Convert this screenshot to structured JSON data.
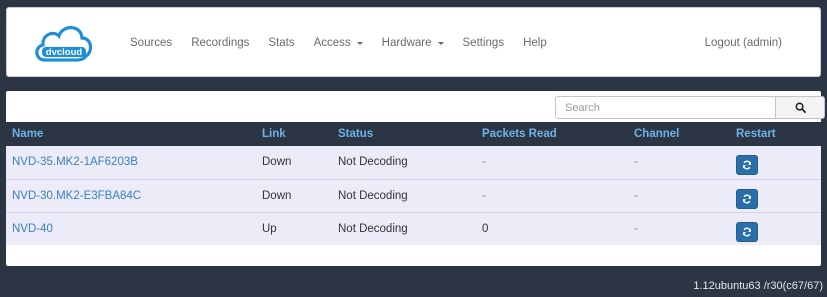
{
  "brand": {
    "logo_text": "dvcloud",
    "accent": "#1e8fd6"
  },
  "nav": {
    "items": [
      {
        "label": "Sources",
        "dropdown": false
      },
      {
        "label": "Recordings",
        "dropdown": false
      },
      {
        "label": "Stats",
        "dropdown": false
      },
      {
        "label": "Access",
        "dropdown": true
      },
      {
        "label": "Hardware",
        "dropdown": true
      },
      {
        "label": "Settings",
        "dropdown": false
      },
      {
        "label": "Help",
        "dropdown": false
      }
    ],
    "logout_label": "Logout (admin)"
  },
  "search": {
    "placeholder": "Search",
    "icon": "search-icon"
  },
  "table": {
    "columns": [
      "Name",
      "Link",
      "Status",
      "Packets Read",
      "Channel",
      "Restart"
    ],
    "rows": [
      {
        "name": "NVD-35.MK2-1AF6203B",
        "link": "Down",
        "status": "Not Decoding",
        "packets_read": "-",
        "channel": "-"
      },
      {
        "name": "NVD-30.MK2-E3FBA84C",
        "link": "Down",
        "status": "Not Decoding",
        "packets_read": "-",
        "channel": "-"
      },
      {
        "name": "NVD-40",
        "link": "Up",
        "status": "Not Decoding",
        "packets_read": "0",
        "channel": "-"
      }
    ],
    "restart_icon": "refresh-icon"
  },
  "footer": {
    "version": "1.12ubuntu63 /r30(c67/67)"
  },
  "colors": {
    "background": "#2b3543",
    "header_text": "#6fb3e6",
    "row_bg": "#ececf9",
    "link": "#3a7fc1",
    "button": "#2a6da8"
  }
}
